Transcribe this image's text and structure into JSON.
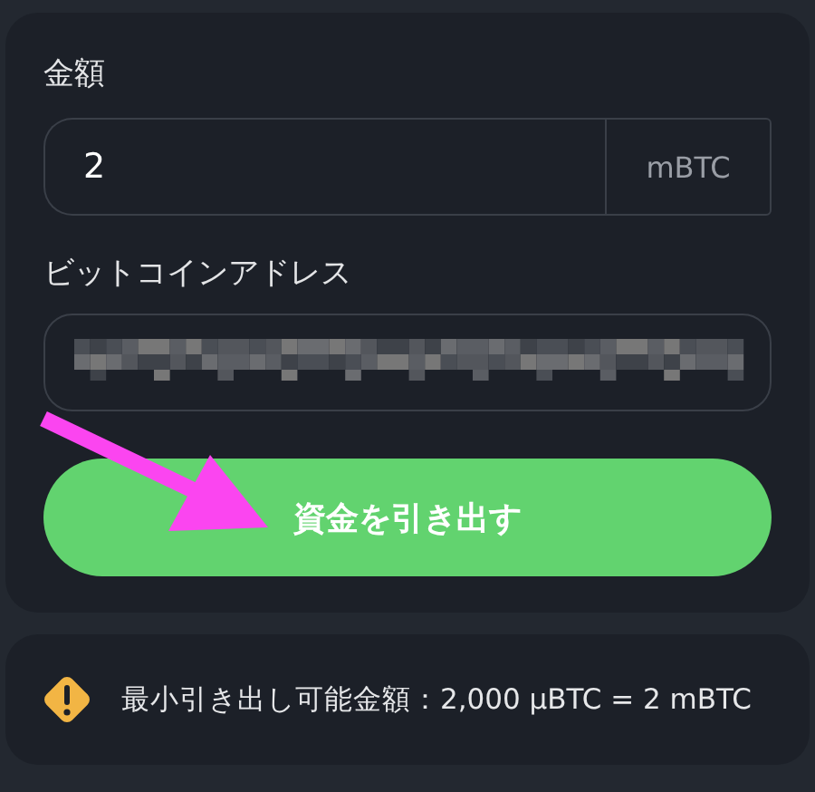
{
  "withdraw_form": {
    "amount_label": "金額",
    "amount": {
      "value": "2",
      "unit": "mBTC"
    },
    "address_label": "ビットコインアドレス",
    "address": {
      "obscured": true
    },
    "submit_button": "資金を引き出す"
  },
  "notice": {
    "kind": "warning",
    "text": "最小引き出し可能金額：2,000 µBTC = 2 mBTC"
  },
  "annotation": {
    "kind": "arrow"
  }
}
